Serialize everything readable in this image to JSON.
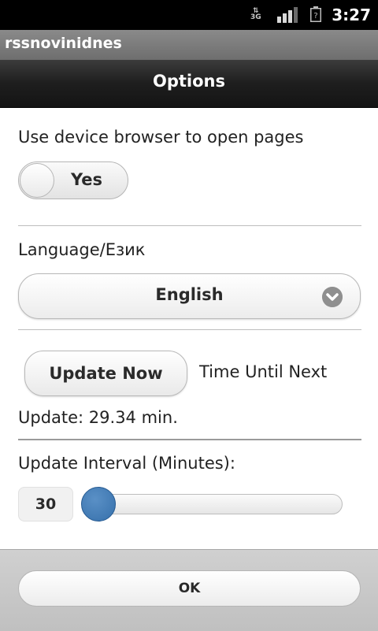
{
  "status_bar": {
    "network": "3G",
    "time": "3:27",
    "icons": [
      "network-3g-icon",
      "signal-icon",
      "battery-unknown-icon"
    ]
  },
  "app": {
    "title": "rssnovinidnes"
  },
  "header": {
    "title": "Options"
  },
  "browser_setting": {
    "label": "Use device browser to open pages",
    "toggle_label": "Yes"
  },
  "language": {
    "label": "Language/Език",
    "selected": "English"
  },
  "update": {
    "button_label": "Update Now",
    "time_until_line1": "Time Until Next",
    "time_until_line2": "Update: 29.34 min."
  },
  "interval": {
    "label": "Update Interval (Minutes):",
    "value_text": "30",
    "slider_fraction": 0.0
  },
  "footer": {
    "ok_label": "OK"
  },
  "colors": {
    "slider_thumb": "#3f79b5",
    "header_bg": "#1e1e1e",
    "app_title_bg": "#7a7a7a"
  }
}
